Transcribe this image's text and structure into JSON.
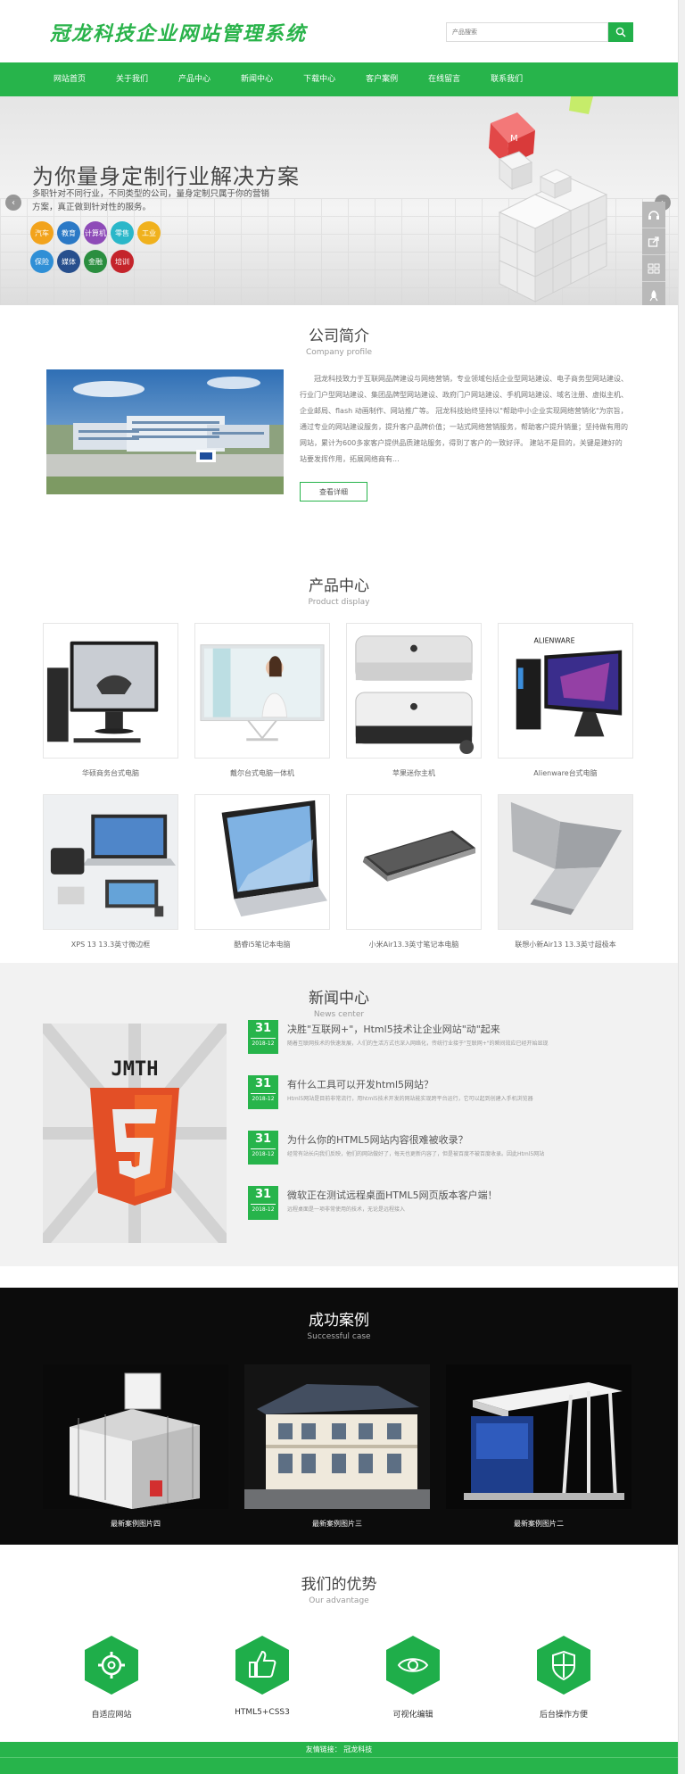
{
  "header": {
    "logo": "冠龙科技企业网站管理系统",
    "search_placeholder": "产品搜索"
  },
  "nav": {
    "items": [
      "网站首页",
      "关于我们",
      "产品中心",
      "新闻中心",
      "下载中心",
      "客户案例",
      "在线留言",
      "联系我们"
    ]
  },
  "banner": {
    "title": "为你量身定制行业解决方案",
    "subtitle": "多职针对不同行业，不同类型的公司，量身定制只属于你的营销方案，真正做到针对性的服务。",
    "tags": [
      {
        "label": "汽车",
        "color": "#f2a31c"
      },
      {
        "label": "教育",
        "color": "#2b79c6"
      },
      {
        "label": "计算机",
        "color": "#8e4bb8"
      },
      {
        "label": "零售",
        "color": "#2ab7c9"
      },
      {
        "label": "工业",
        "color": "#f0b11d"
      },
      {
        "label": "保险",
        "color": "#2f8fd6"
      },
      {
        "label": "媒体",
        "color": "#274f8d"
      },
      {
        "label": "金融",
        "color": "#2a8e3f"
      },
      {
        "label": "培训",
        "color": "#c4242b"
      }
    ]
  },
  "profile": {
    "title_cn": "公司简介",
    "title_en": "Company profile",
    "text": "冠龙科技致力于互联网品牌建设与网络营销，专业领域包括企业型网站建设、电子商务型网站建设、行业门户型网站建设、集团品牌型网站建设、政府门户网站建设、手机网站建设、域名注册、虚拟主机、企业邮局、flash 动画制作、网站推广等。 冠龙科技始终坚持以\"帮助中小企业实现网络营销化\"为宗旨，通过专业的网站建设服务，提升客户品牌价值；一站式网络营销服务，帮助客户提升销量；坚持做有用的网站，累计为600多家客户提供品质建站服务，得到了客户的一致好评。 建站不是目的，关键是建好的站要发挥作用，拓展网络商有...",
    "more_label": "查看详细"
  },
  "products": {
    "title_cn": "产品中心",
    "title_en": "Product display",
    "items": [
      "华硕商务台式电脑",
      "戴尔台式电脑一体机",
      "苹果迷你主机",
      "Alienware台式电脑",
      "XPS 13 13.3英寸微边框",
      "酷睿i5笔记本电脑",
      "小米Air13.3英寸笔记本电脑",
      "联想小新Air13 13.3英寸超极本"
    ],
    "brand_text": "ALIENWARE"
  },
  "news": {
    "title_cn": "新闻中心",
    "title_en": "News center",
    "logo_text": "JMTH",
    "items": [
      {
        "day": "31",
        "ym": "2018-12",
        "title": "决胜\"互联网+\"，Html5技术让企业网站\"动\"起来",
        "summary": "随着互联网技术的快速发展，人们的生活方式也深入网络化，传统行业接于\"互联网+\"的瞬间效应已经开始显现"
      },
      {
        "day": "31",
        "ym": "2018-12",
        "title": "有什么工具可以开发html5网站？",
        "summary": "Html5网站是目前非常流行，用html5技术开发的网站能实现跨平台运行，它可以起到创建入手机浏览器"
      },
      {
        "day": "31",
        "ym": "2018-12",
        "title": "为什么你的HTML5网站内容很难被收录？",
        "summary": "经常有站长向我们反映，他们的网站做好了，每天也更新内容了，但是被百度不被百度收录。因此Html5网站"
      },
      {
        "day": "31",
        "ym": "2018-12",
        "title": "微软正在测试远程桌面HTML5网页版本客户端！",
        "summary": "远程桌面是一项非常使用的技术，无论是远程接入"
      }
    ]
  },
  "cases": {
    "title_cn": "成功案例",
    "title_en": "Successful case",
    "items": [
      "最新案例图片四",
      "最新案例图片三",
      "最新案例图片二"
    ]
  },
  "advantages": {
    "title_cn": "我们的优势",
    "title_en": "Our advantage",
    "items": [
      {
        "label": "自适应网站",
        "icon": "gear-icon"
      },
      {
        "label": "HTML5+CSS3",
        "icon": "thumbs-up-icon"
      },
      {
        "label": "可视化编辑",
        "icon": "eye-icon"
      },
      {
        "label": "后台操作方便",
        "icon": "shield-icon"
      }
    ]
  },
  "footer": {
    "friend_label": "友情链接：",
    "friend_link": "冠龙科技"
  },
  "colors": {
    "brand": "#27b44b",
    "dark": "#0c0c0c"
  }
}
